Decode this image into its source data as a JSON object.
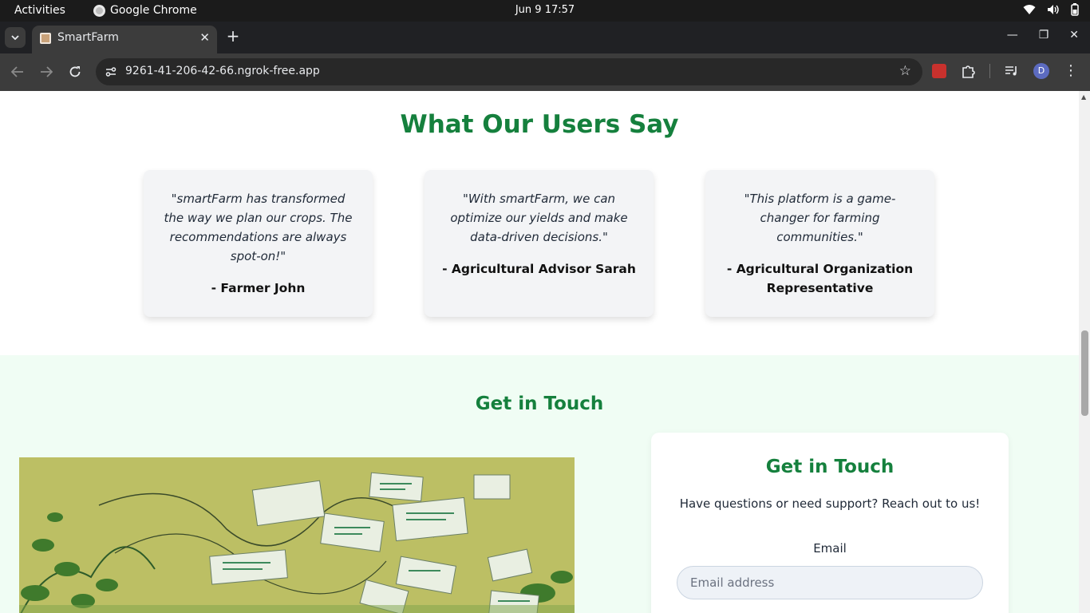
{
  "system_bar": {
    "activities": "Activities",
    "app_name": "Google Chrome",
    "clock": "Jun 9  17:57"
  },
  "browser": {
    "tab_title": "SmartFarm",
    "url": "9261-41-206-42-66.ngrok-free.app",
    "profile_initial": "D"
  },
  "testimonials": {
    "heading": "What Our Users Say",
    "items": [
      {
        "quote": "\"smartFarm has transformed the way we plan our crops. The recommendations are always spot-on!\"",
        "author": "- Farmer John"
      },
      {
        "quote": "\"With smartFarm, we can optimize our yields and make data-driven decisions.\"",
        "author": "- Agricultural Advisor Sarah"
      },
      {
        "quote": "\"This platform is a game-changer for farming communities.\"",
        "author": "- Agricultural Organization Representative"
      }
    ]
  },
  "contact": {
    "heading": "Get in Touch",
    "card_heading": "Get in Touch",
    "subtitle": "Have questions or need support? Reach out to us!",
    "email_label": "Email",
    "email_value": "",
    "email_placeholder": "Email address"
  },
  "colors": {
    "accent_green": "#15803d",
    "contact_bg": "#f0fdf4",
    "card_bg": "#f3f4f6"
  }
}
